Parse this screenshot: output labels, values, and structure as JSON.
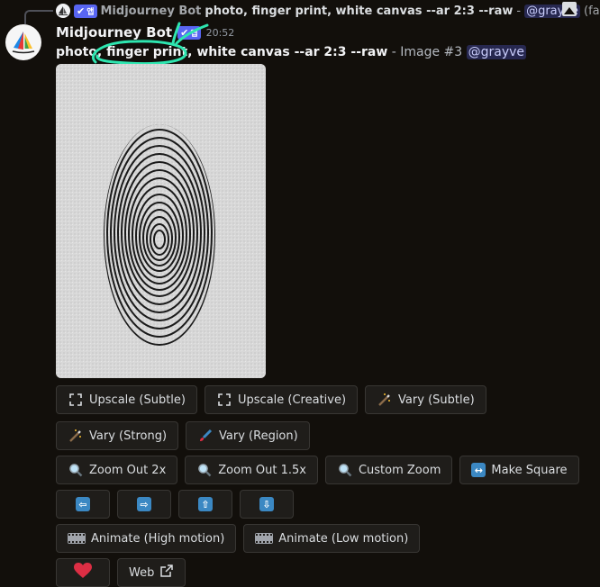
{
  "reply": {
    "author": "Midjourney Bot",
    "badge_label": "앱",
    "text": "photo, finger print, white canvas --ar 2:3 --raw",
    "separator": "-",
    "mention": "@grayve",
    "trail": "(fast,..."
  },
  "message": {
    "author": "Midjourney Bot",
    "badge_label": "앱",
    "timestamp": "20:52",
    "prompt": "photo, finger print, white canvas --ar 2:3 --raw",
    "meta": " - Image #3 ",
    "mention": "@grayve"
  },
  "buttons": {
    "row1": [
      {
        "label": "Upscale (Subtle)",
        "icon": "expand-icon"
      },
      {
        "label": "Upscale (Creative)",
        "icon": "expand-icon"
      },
      {
        "label": "Vary (Subtle)",
        "icon": "magic-wand-icon"
      }
    ],
    "row2": [
      {
        "label": "Vary (Strong)",
        "icon": "magic-wand-icon"
      },
      {
        "label": "Vary (Region)",
        "icon": "paintbrush-icon"
      }
    ],
    "row3": [
      {
        "label": "Zoom Out 2x",
        "icon": "magnifier-icon"
      },
      {
        "label": "Zoom Out 1.5x",
        "icon": "magnifier-icon"
      },
      {
        "label": "Custom Zoom",
        "icon": "magnifier-icon"
      },
      {
        "label": "Make Square",
        "icon": "left-right-arrow-icon"
      }
    ],
    "row4": [
      {
        "icon": "arrow-left-icon",
        "glyph": "⇦"
      },
      {
        "icon": "arrow-right-icon",
        "glyph": "⇨"
      },
      {
        "icon": "arrow-up-icon",
        "glyph": "⇧"
      },
      {
        "icon": "arrow-down-icon",
        "glyph": "⇩"
      }
    ],
    "row5": [
      {
        "label": "Animate (High motion)",
        "icon": "film-icon"
      },
      {
        "label": "Animate (Low motion)",
        "icon": "film-icon"
      }
    ],
    "row6": {
      "favorite_icon": "heart-icon",
      "web_label": "Web",
      "web_icon": "external-link-icon"
    }
  },
  "colors": {
    "background": "#120f0b",
    "badge": "#5865f2",
    "annotation": "#2ee6b0",
    "arrow_buttons": "#3b88c3",
    "heart": "#dd2e44"
  }
}
